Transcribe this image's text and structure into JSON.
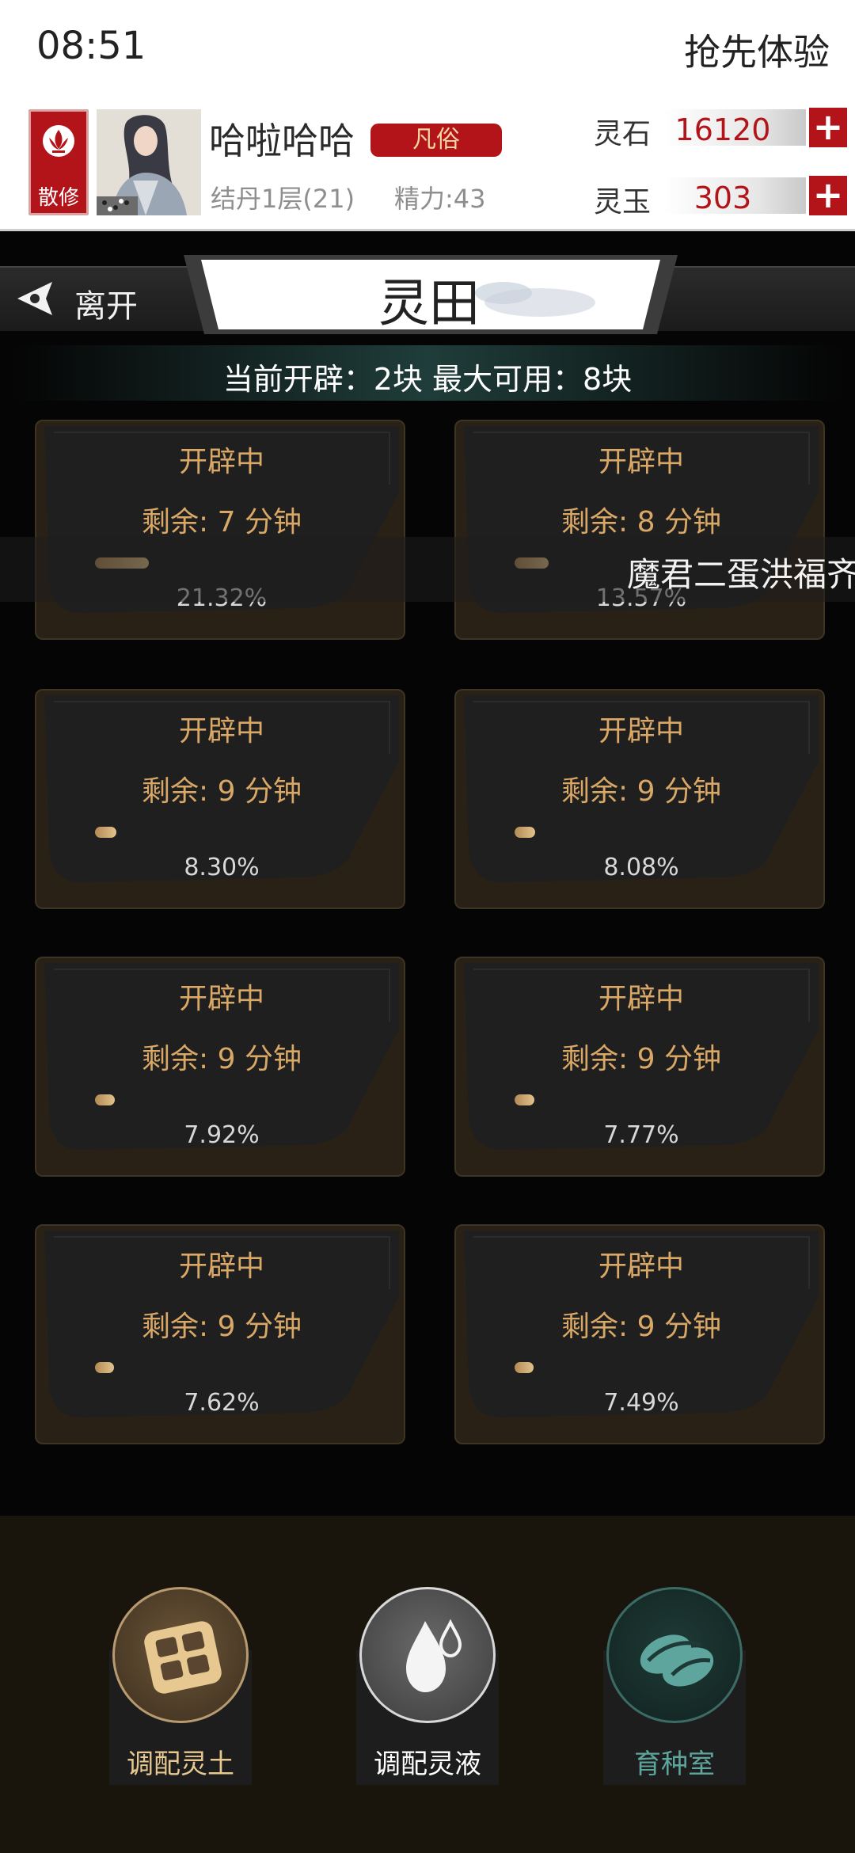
{
  "status_bar": {
    "time": "08:51",
    "promo": "抢先体验"
  },
  "player": {
    "sect_label": "散修",
    "name": "哈啦哈哈",
    "rank": "凡俗",
    "realm": "结丹1层(21)",
    "energy": "精力:43"
  },
  "resources": [
    {
      "label": "灵石",
      "value": "16120",
      "plus": "+"
    },
    {
      "label": "灵玉",
      "value": "303",
      "plus": "+"
    }
  ],
  "nav": {
    "leave_label": "离开",
    "title": "灵田"
  },
  "field_info": "当前开辟：2块  最大可用：8块",
  "marquee": "魔君二蛋洪福齐",
  "plots": [
    {
      "status": "开辟中",
      "remaining": "剩余: 7 分钟",
      "progress_label": "21.32%",
      "progress": 0.2132
    },
    {
      "status": "开辟中",
      "remaining": "剩余: 8 分钟",
      "progress_label": "13.57%",
      "progress": 0.1357
    },
    {
      "status": "开辟中",
      "remaining": "剩余: 9 分钟",
      "progress_label": "8.30%",
      "progress": 0.083
    },
    {
      "status": "开辟中",
      "remaining": "剩余: 9 分钟",
      "progress_label": "8.08%",
      "progress": 0.0808
    },
    {
      "status": "开辟中",
      "remaining": "剩余: 9 分钟",
      "progress_label": "7.92%",
      "progress": 0.0792
    },
    {
      "status": "开辟中",
      "remaining": "剩余: 9 分钟",
      "progress_label": "7.77%",
      "progress": 0.0777
    },
    {
      "status": "开辟中",
      "remaining": "剩余: 9 分钟",
      "progress_label": "7.62%",
      "progress": 0.0762
    },
    {
      "status": "开辟中",
      "remaining": "剩余: 9 分钟",
      "progress_label": "7.49%",
      "progress": 0.0749
    }
  ],
  "actions": [
    {
      "label": "调配灵土",
      "icon": "soil-tiles-icon"
    },
    {
      "label": "调配灵液",
      "icon": "water-drop-icon"
    },
    {
      "label": "育种室",
      "icon": "seed-icon"
    }
  ],
  "colors": {
    "accent_red": "#b3141a",
    "plot_text": "#d9a866",
    "seed_teal": "#5ea69d"
  }
}
